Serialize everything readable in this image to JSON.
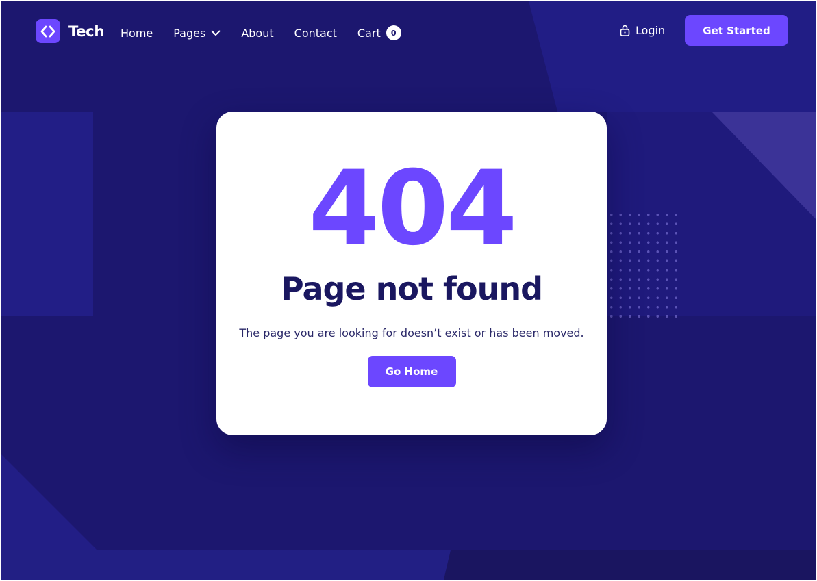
{
  "brand": {
    "name": "Tech",
    "logo_icon": "code-brackets-icon"
  },
  "nav": {
    "items": [
      {
        "label": "Home"
      },
      {
        "label": "Pages",
        "icon": "chevron-down-icon"
      },
      {
        "label": "About"
      },
      {
        "label": "Contact"
      },
      {
        "label": "Cart",
        "badge": "0"
      }
    ],
    "login_label": "Login",
    "login_icon": "lock-icon",
    "cta_label": "Get Started"
  },
  "error": {
    "code": "404",
    "title": "Page not found",
    "message": "The page you are looking for doesn’t exist or has been moved.",
    "button_label": "Go Home"
  },
  "colors": {
    "accent": "#6c47ff",
    "background": "#1c176f",
    "heading": "#1a1760"
  }
}
